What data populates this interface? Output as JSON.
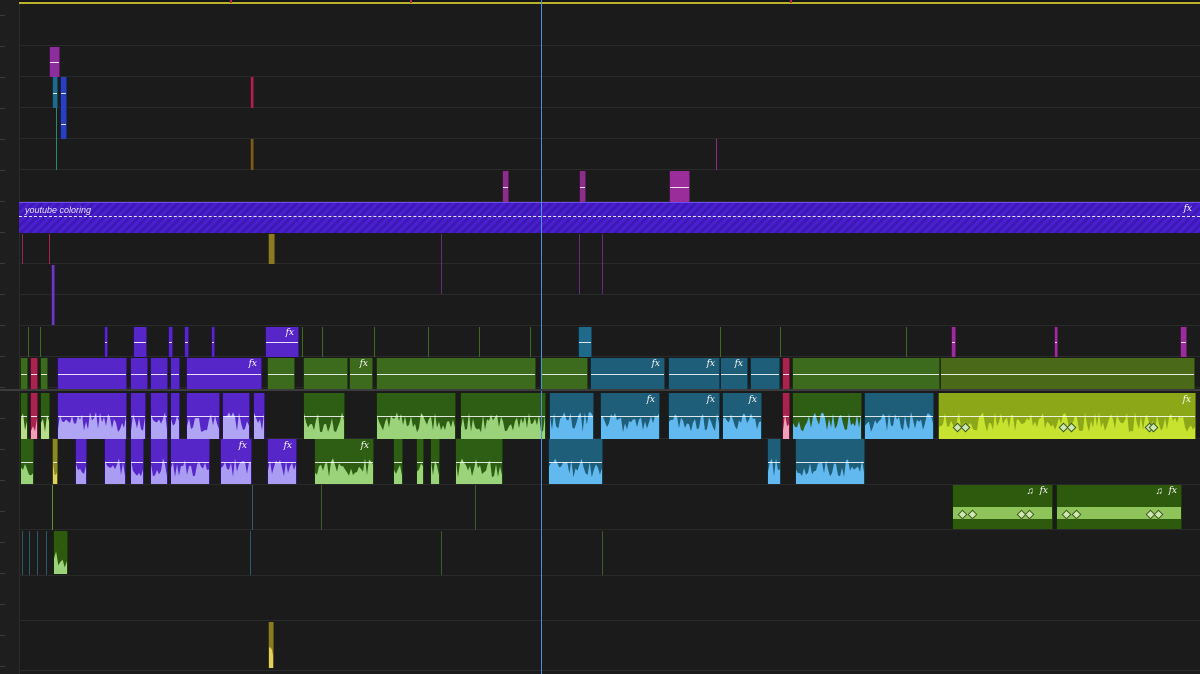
{
  "timeline": {
    "adjustment_layer": {
      "label": "youtube coloring",
      "fx": "fx"
    },
    "fx_badge": "fx",
    "music_icon": "♫",
    "colors": {
      "background": "#1b1b1b",
      "playhead": "#4a90e2",
      "ruler_bar": "#b9b22a",
      "adjustment_purple": "#4a1fd0",
      "video_purple": "#5626c9",
      "video_green": "#3d6b1e",
      "video_teal": "#1f5e78",
      "audio_purple": "#a99cf2",
      "audio_green": "#9bd37a",
      "audio_blue": "#62b9f0",
      "audio_lime": "#b7d72a",
      "marker_magenta": "#8b2d8a",
      "marker_crimson": "#a8244e"
    }
  }
}
